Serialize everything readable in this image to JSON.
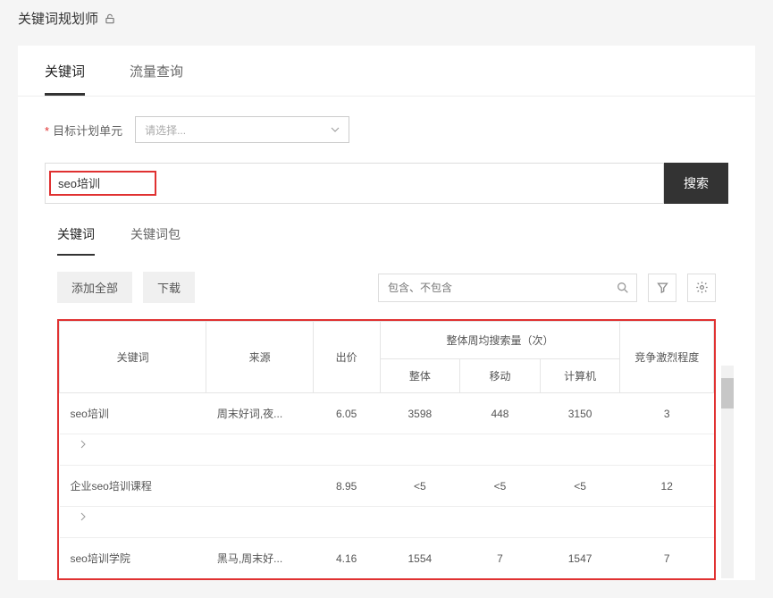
{
  "header": {
    "title": "关键词规划师"
  },
  "tabs": {
    "items": [
      {
        "label": "关键词",
        "active": true
      },
      {
        "label": "流量查询",
        "active": false
      }
    ]
  },
  "form": {
    "target_plan_label": "目标计划单元",
    "select_placeholder": "请选择..."
  },
  "search": {
    "value": "seo培训",
    "button": "搜索"
  },
  "sub_tabs": {
    "items": [
      {
        "label": "关键词",
        "active": true
      },
      {
        "label": "关键词包",
        "active": false
      }
    ]
  },
  "toolbar": {
    "add_all": "添加全部",
    "download": "下载",
    "filter_placeholder": "包含、不包含"
  },
  "table": {
    "headers": {
      "keyword": "关键词",
      "source": "来源",
      "bid": "出价",
      "search_volume_group": "整体周均搜索量（次）",
      "overall": "整体",
      "mobile": "移动",
      "pc": "计算机",
      "competition": "竞争激烈程度"
    },
    "rows": [
      {
        "keyword": "seo培训",
        "source": "周末好词,夜...",
        "bid": "6.05",
        "overall": "3598",
        "mobile": "448",
        "pc": "3150",
        "competition": "3",
        "expandable": true
      },
      {
        "keyword": "企业seo培训课程",
        "source": "",
        "bid": "8.95",
        "overall": "<5",
        "mobile": "<5",
        "pc": "<5",
        "competition": "12",
        "expandable": true
      },
      {
        "keyword": "seo培训学院",
        "source": "黑马,周末好...",
        "bid": "4.16",
        "overall": "1554",
        "mobile": "7",
        "pc": "1547",
        "competition": "7",
        "expandable": false
      }
    ]
  }
}
